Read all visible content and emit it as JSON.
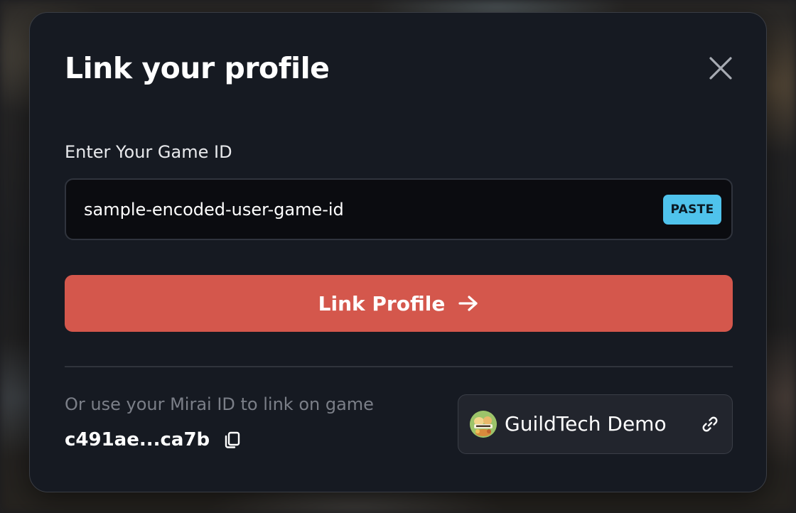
{
  "modal": {
    "title": "Link your profile"
  },
  "game_id": {
    "label": "Enter Your Game ID",
    "value": "sample-encoded-user-game-id",
    "paste_label": "PASTE"
  },
  "link_button": {
    "label": "Link Profile",
    "icon": "arrow-right-icon"
  },
  "mirai": {
    "hint": "Or use your Mirai ID to link on game",
    "id": "c491ae...ca7b"
  },
  "game": {
    "name": "GuildTech Demo"
  },
  "icons": {
    "close": "close-icon",
    "copy": "copy-icon",
    "link": "link-icon",
    "game_avatar": "game-avatar-image"
  },
  "colors": {
    "modal_bg": "#161a22",
    "accent_button": "#d4574c",
    "paste_button": "#4fc3ec",
    "input_bg": "#0b0c10",
    "muted_text": "#7b7f88"
  }
}
